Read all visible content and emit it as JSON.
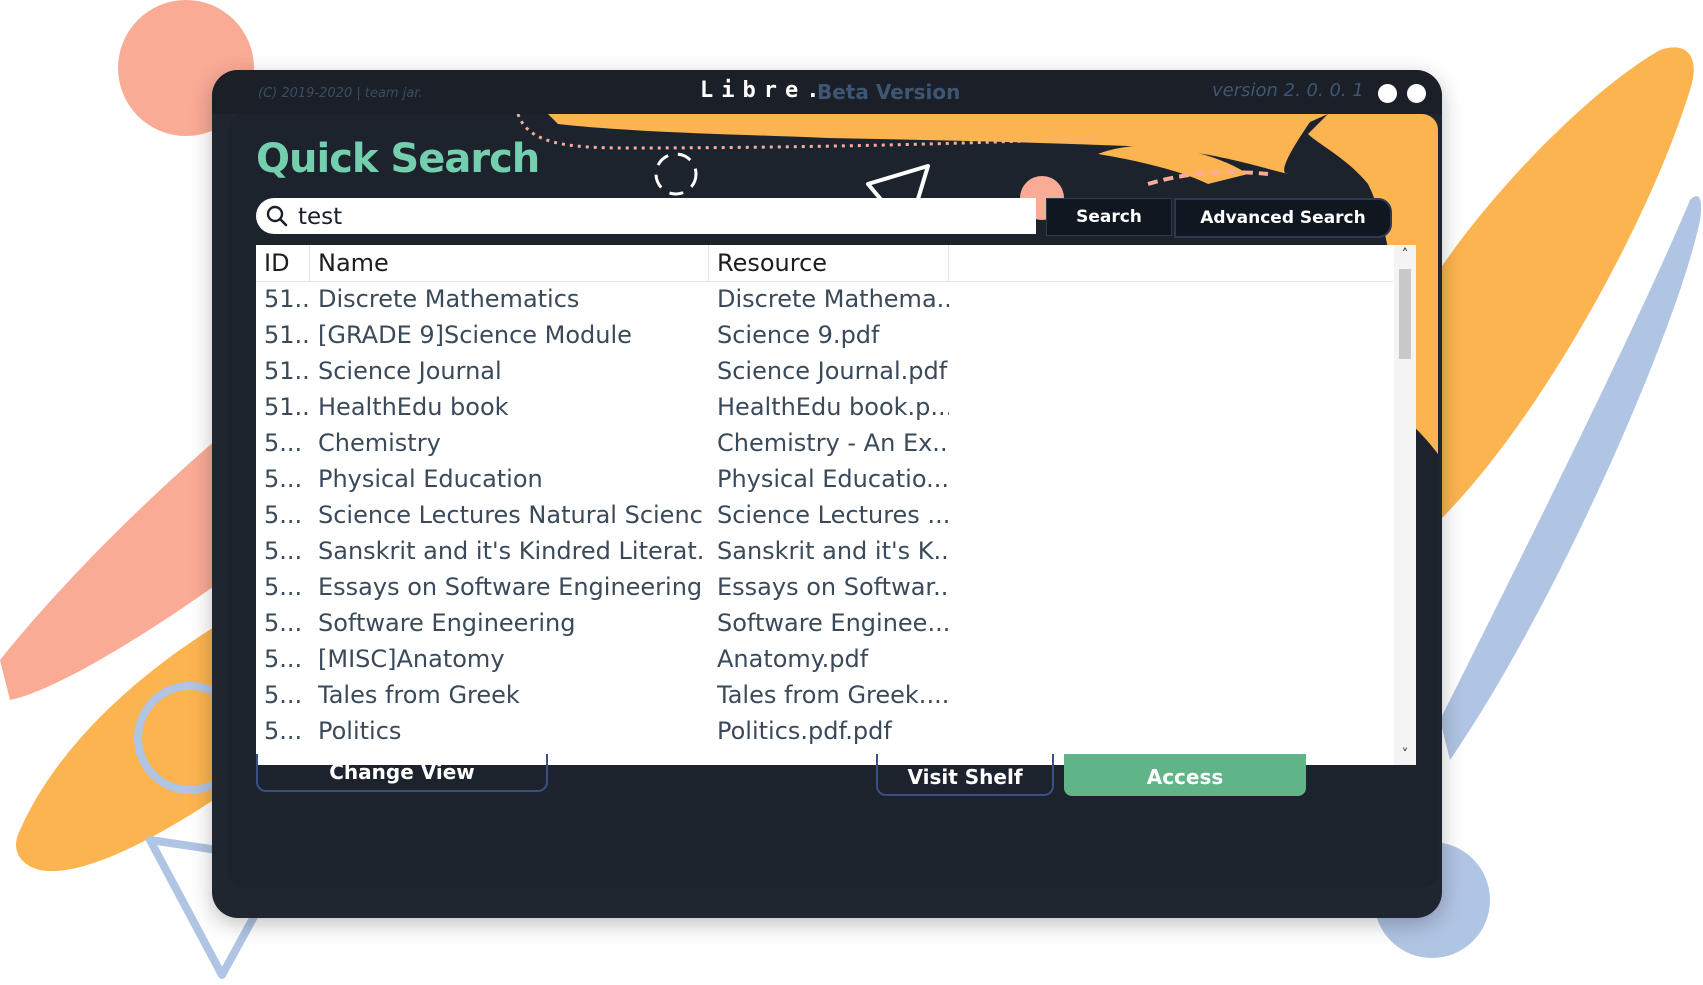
{
  "window": {
    "copyright": "(C) 2019-2020 | team jar.",
    "app_title": "Libre.",
    "beta_label": "Beta Version",
    "version": "version 2. 0. 0. 1"
  },
  "page": {
    "title": "Quick Search"
  },
  "search": {
    "value": "test",
    "search_button": "Search",
    "advanced_button": "Advanced Search"
  },
  "table": {
    "columns": [
      "ID",
      "Name",
      "Resource"
    ],
    "rows": [
      {
        "id": "51...",
        "name": "Discrete Mathematics",
        "resource": "Discrete Mathema..."
      },
      {
        "id": "51...",
        "name": "[GRADE 9]Science Module",
        "resource": "Science 9.pdf"
      },
      {
        "id": "51...",
        "name": "Science Journal",
        "resource": "Science Journal.pdf"
      },
      {
        "id": "51...",
        "name": "HealthEdu book",
        "resource": "HealthEdu book.p..."
      },
      {
        "id": "5...",
        "name": "Chemistry",
        "resource": "Chemistry - An Ex..."
      },
      {
        "id": "5...",
        "name": "Physical Education",
        "resource": "Physical Educatio..."
      },
      {
        "id": "5...",
        "name": "Science Lectures Natural Science",
        "resource": "Science Lectures ..."
      },
      {
        "id": "5...",
        "name": "Sanskrit and it's Kindred Literat...",
        "resource": "Sanskrit and it's K..."
      },
      {
        "id": "5...",
        "name": "Essays on Software Engineering",
        "resource": "Essays on Softwar..."
      },
      {
        "id": "5...",
        "name": "Software Engineering",
        "resource": "Software Enginee..."
      },
      {
        "id": "5...",
        "name": "[MISC]Anatomy",
        "resource": "Anatomy.pdf"
      },
      {
        "id": "5...",
        "name": "Tales from Greek",
        "resource": "Tales from Greek...."
      },
      {
        "id": "5...",
        "name": "Politics",
        "resource": "Politics.pdf.pdf"
      }
    ]
  },
  "buttons": {
    "change_view": "Change View",
    "visit_shelf": "Visit Shelf",
    "access": "Access"
  },
  "icons": {
    "search": "search-icon",
    "scroll_up": "chevron-up-icon",
    "scroll_down": "chevron-down-icon"
  },
  "colors": {
    "accent_green": "#74cfae",
    "access_green": "#5fb587",
    "window_bg": "#1f2630",
    "deco_orange": "#fbb450",
    "deco_salmon": "#f9ab96",
    "deco_blue": "#b0c4e4"
  }
}
